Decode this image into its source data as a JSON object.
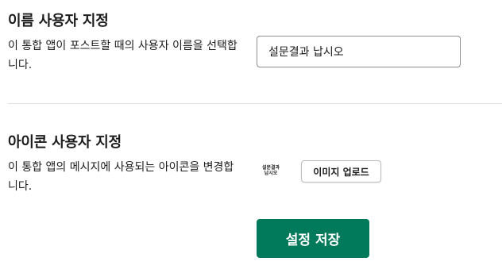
{
  "name_section": {
    "title": "이름 사용자 지정",
    "description": "이 통합 앱이 포스트할 때의 사용자 이름을 선택합니다.",
    "input_value": "설문결과 납시오"
  },
  "icon_section": {
    "title": "아이콘 사용자 지정",
    "description": "이 통합 앱의 메시지에 사용되는 아이콘을 변경합니다.",
    "icon_preview_line1": "설문결과",
    "icon_preview_line2": "납시오",
    "upload_label": "이미지 업로드"
  },
  "save_label": "설정 저장",
  "colors": {
    "primary": "#007a5a",
    "divider": "#e2e2e2",
    "text": "#1d1c1d"
  }
}
